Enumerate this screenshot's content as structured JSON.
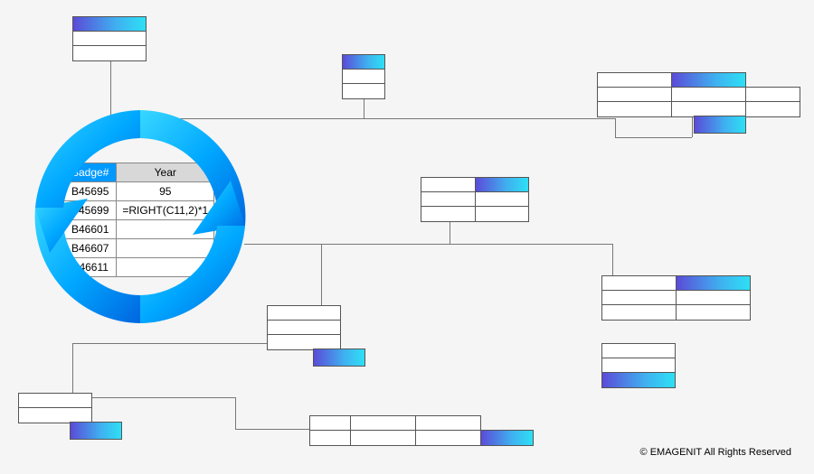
{
  "table": {
    "headers": {
      "badge": "Badge#",
      "year": "Year"
    },
    "rows": [
      {
        "badge": "B45695",
        "year": "95"
      },
      {
        "badge": "B45699",
        "year": "=RIGHT(C11,2)*1"
      },
      {
        "badge": "B46601",
        "year": ""
      },
      {
        "badge": "B46607",
        "year": ""
      },
      {
        "badge": "B46611",
        "year": ""
      }
    ]
  },
  "footer": "© EMAGENIT All Rights Reserved",
  "icons": {
    "ring": "circular-arrows-icon"
  }
}
